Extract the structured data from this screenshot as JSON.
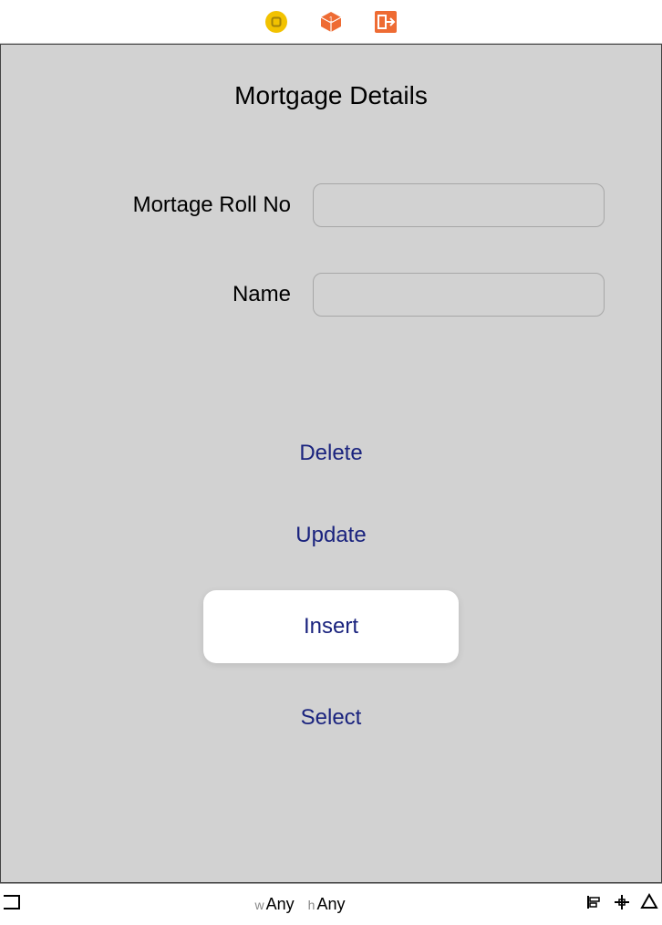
{
  "toolbar": {
    "icons": [
      "coin-icon",
      "cube-icon",
      "logout-icon"
    ]
  },
  "page": {
    "title": "Mortgage Details"
  },
  "form": {
    "rollno_label": "Mortage Roll No",
    "rollno_value": "",
    "name_label": "Name",
    "name_value": ""
  },
  "actions": {
    "delete": "Delete",
    "update": "Update",
    "insert": "Insert",
    "select": "Select",
    "selected": "insert"
  },
  "bottombar": {
    "w_prefix": "w",
    "w_value": "Any",
    "h_prefix": "h",
    "h_value": "Any"
  }
}
